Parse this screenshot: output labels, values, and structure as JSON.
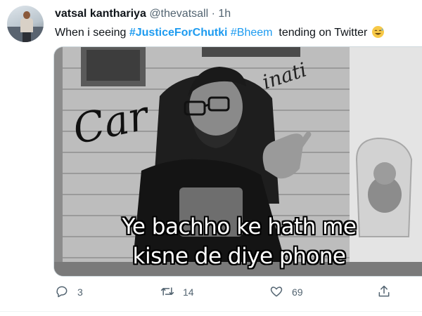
{
  "tweet": {
    "author_name": "vatsal kanthariya",
    "handle": "@thevatsall",
    "separator": "·",
    "time": "1h",
    "text_prefix": "When i seeing ",
    "hashtag_1": "#JusticeForChutki",
    "hashtag_2": "#Bheem",
    "text_suffix": "  tending on Twitter",
    "emoji_icon": "grinning-sweat-emoji-icon"
  },
  "media": {
    "caption_line1": "Ye bachho ke hath me",
    "caption_line2": "kisne de diye phone",
    "wall_sign": "CarryMinati"
  },
  "actions": {
    "reply_count": "3",
    "retweet_count": "14",
    "like_count": "69",
    "reply_icon": "speech-bubble-icon",
    "retweet_icon": "retweet-arrows-icon",
    "like_icon": "heart-icon",
    "share_icon": "share-upload-icon"
  },
  "colors": {
    "link": "#1d9bf0",
    "secondary_text": "#536471",
    "primary_text": "#0f1419"
  }
}
